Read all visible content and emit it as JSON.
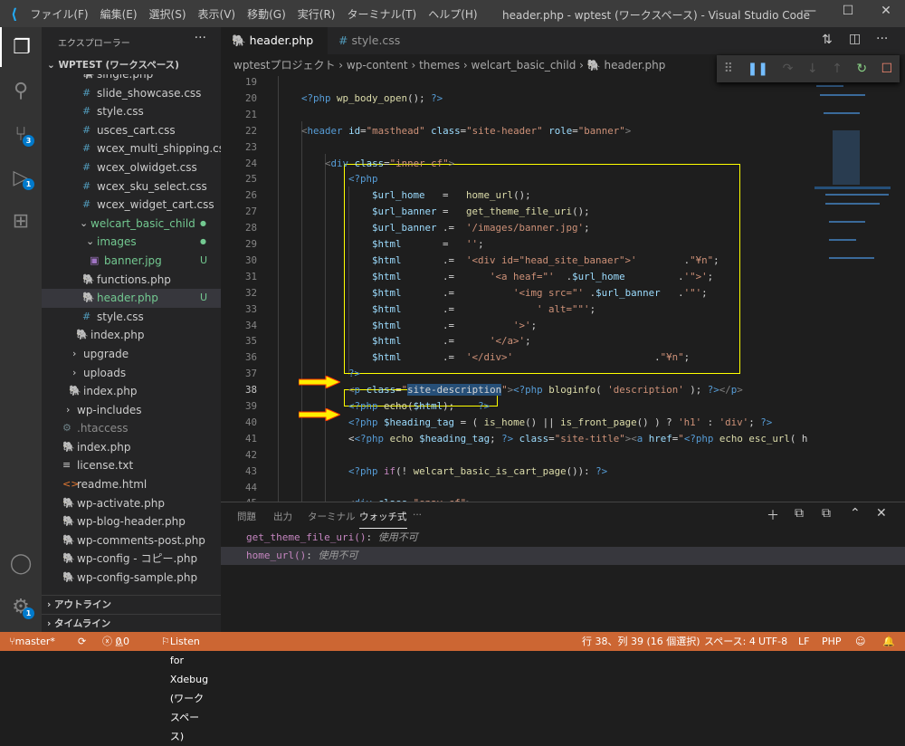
{
  "titlebar": {
    "menus": [
      "ファイル(F)",
      "編集(E)",
      "選択(S)",
      "表示(V)",
      "移動(G)",
      "実行(R)",
      "ターミナル(T)",
      "ヘルプ(H)"
    ],
    "title": "header.php - wptest (ワークスペース) - Visual Studio Code"
  },
  "activity": {
    "scm_badge": "3",
    "debug_badge": "1",
    "settings_badge": "1"
  },
  "sidebar": {
    "header": "エクスプローラー",
    "workspace": "WPTEST (ワークスペース)",
    "items": [
      {
        "label": "single.php",
        "type": "php",
        "indent": 107
      },
      {
        "label": "slide_showcase.css",
        "type": "css",
        "indent": 107
      },
      {
        "label": "style.css",
        "type": "css",
        "indent": 107
      },
      {
        "label": "usces_cart.css",
        "type": "css",
        "indent": 107
      },
      {
        "label": "wcex_multi_shipping.css",
        "type": "css",
        "indent": 107
      },
      {
        "label": "wcex_olwidget.css",
        "type": "css",
        "indent": 107
      },
      {
        "label": "wcex_sku_select.css",
        "type": "css",
        "indent": 107
      },
      {
        "label": "wcex_widget_cart.css",
        "type": "css",
        "indent": 107
      },
      {
        "label": "welcart_basic_child",
        "type": "folder-open",
        "indent": 100,
        "git": "dot"
      },
      {
        "label": "images",
        "type": "folder-open",
        "indent": 107,
        "git": "dot"
      },
      {
        "label": "banner.jpg",
        "type": "image",
        "indent": 115,
        "git": "U"
      },
      {
        "label": "functions.php",
        "type": "php",
        "indent": 107
      },
      {
        "label": "header.php",
        "type": "php",
        "indent": 107,
        "git": "U",
        "selected": true
      },
      {
        "label": "style.css",
        "type": "css",
        "indent": 107
      },
      {
        "label": "index.php",
        "type": "php",
        "indent": 100
      },
      {
        "label": "upgrade",
        "type": "folder",
        "indent": 92
      },
      {
        "label": "uploads",
        "type": "folder",
        "indent": 92
      },
      {
        "label": "index.php",
        "type": "php",
        "indent": 92
      },
      {
        "label": "wp-includes",
        "type": "folder",
        "indent": 85
      },
      {
        "label": ".htaccess",
        "type": "config",
        "indent": 85
      },
      {
        "label": "index.php",
        "type": "php",
        "indent": 85
      },
      {
        "label": "license.txt",
        "type": "text",
        "indent": 85
      },
      {
        "label": "readme.html",
        "type": "html",
        "indent": 85
      },
      {
        "label": "wp-activate.php",
        "type": "php",
        "indent": 85
      },
      {
        "label": "wp-blog-header.php",
        "type": "php",
        "indent": 85
      },
      {
        "label": "wp-comments-post.php",
        "type": "php",
        "indent": 85
      },
      {
        "label": "wp-config - コピー.php",
        "type": "php",
        "indent": 85
      },
      {
        "label": "wp-config-sample.php",
        "type": "php",
        "indent": 85
      }
    ],
    "outline": "アウトライン",
    "timeline": "タイムライン"
  },
  "tabs": [
    {
      "label": "header.php",
      "icon": "php-icon",
      "active": true
    },
    {
      "label": "style.css",
      "icon": "css-icon",
      "active": false
    }
  ],
  "breadcrumb": [
    "wptestプロジェクト",
    "wp-content",
    "themes",
    "welcart_basic_child",
    "header.php"
  ],
  "code": [
    {
      "n": "19",
      "t": []
    },
    {
      "n": "20",
      "t": [
        [
          "    ",
          "o"
        ],
        [
          "<?php",
          "d"
        ],
        [
          " ",
          "o"
        ],
        [
          "wp_body_open",
          "f"
        ],
        [
          "(); ",
          "o"
        ],
        [
          "?>",
          "d"
        ]
      ]
    },
    {
      "n": "21",
      "t": []
    },
    {
      "n": "22",
      "t": [
        [
          "    ",
          "o"
        ],
        [
          "<",
          "p"
        ],
        [
          "header",
          "t"
        ],
        [
          " ",
          "o"
        ],
        [
          "id",
          "a"
        ],
        [
          "=",
          "o"
        ],
        [
          "\"masthead\"",
          "s"
        ],
        [
          " ",
          "o"
        ],
        [
          "class",
          "a"
        ],
        [
          "=",
          "o"
        ],
        [
          "\"site-header\"",
          "s"
        ],
        [
          " ",
          "o"
        ],
        [
          "role",
          "a"
        ],
        [
          "=",
          "o"
        ],
        [
          "\"banner\"",
          "s"
        ],
        [
          ">",
          "p"
        ]
      ]
    },
    {
      "n": "23",
      "t": []
    },
    {
      "n": "24",
      "t": [
        [
          "        ",
          "o"
        ],
        [
          "<",
          "p"
        ],
        [
          "div",
          "t"
        ],
        [
          " ",
          "o"
        ],
        [
          "class",
          "a"
        ],
        [
          "=",
          "o"
        ],
        [
          "\"inner cf\"",
          "s"
        ],
        [
          ">",
          "p"
        ]
      ]
    },
    {
      "n": "25",
      "t": [
        [
          "            ",
          "o"
        ],
        [
          "<?php",
          "d"
        ]
      ]
    },
    {
      "n": "26",
      "t": [
        [
          "                ",
          "o"
        ],
        [
          "$url_home",
          "v"
        ],
        [
          "   =   ",
          "o"
        ],
        [
          "home_url",
          "f"
        ],
        [
          "();",
          "o"
        ]
      ]
    },
    {
      "n": "27",
      "t": [
        [
          "                ",
          "o"
        ],
        [
          "$url_banner",
          "v"
        ],
        [
          " =   ",
          "o"
        ],
        [
          "get_theme_file_uri",
          "f"
        ],
        [
          "();",
          "o"
        ]
      ]
    },
    {
      "n": "28",
      "t": [
        [
          "                ",
          "o"
        ],
        [
          "$url_banner",
          "v"
        ],
        [
          " .=  ",
          "o"
        ],
        [
          "'/images/banner.jpg'",
          "s"
        ],
        [
          ";",
          "o"
        ]
      ]
    },
    {
      "n": "29",
      "t": [
        [
          "                ",
          "o"
        ],
        [
          "$html",
          "v"
        ],
        [
          "       =   ",
          "o"
        ],
        [
          "''",
          "s"
        ],
        [
          ";",
          "o"
        ]
      ]
    },
    {
      "n": "30",
      "t": [
        [
          "                ",
          "o"
        ],
        [
          "$html",
          "v"
        ],
        [
          "       .=  ",
          "o"
        ],
        [
          "'<div id=\"head_site_banaer\">'",
          "s"
        ],
        [
          "        .",
          "o"
        ],
        [
          "\"¥n\"",
          "s"
        ],
        [
          ";",
          "o"
        ]
      ]
    },
    {
      "n": "31",
      "t": [
        [
          "                ",
          "o"
        ],
        [
          "$html",
          "v"
        ],
        [
          "       .=      ",
          "o"
        ],
        [
          "'<a heaf=\"'",
          "s"
        ],
        [
          "  .",
          "o"
        ],
        [
          "$url_home",
          "v"
        ],
        [
          "         .",
          "o"
        ],
        [
          "'\">'",
          "s"
        ],
        [
          ";",
          "o"
        ]
      ]
    },
    {
      "n": "32",
      "t": [
        [
          "                ",
          "o"
        ],
        [
          "$html",
          "v"
        ],
        [
          "       .=          ",
          "o"
        ],
        [
          "'<img src=\"'",
          "s"
        ],
        [
          " .",
          "o"
        ],
        [
          "$url_banner",
          "v"
        ],
        [
          "   .",
          "o"
        ],
        [
          "'\"'",
          "s"
        ],
        [
          ";",
          "o"
        ]
      ]
    },
    {
      "n": "33",
      "t": [
        [
          "                ",
          "o"
        ],
        [
          "$html",
          "v"
        ],
        [
          "       .=              ",
          "o"
        ],
        [
          "' alt=\"\"'",
          "s"
        ],
        [
          ";",
          "o"
        ]
      ]
    },
    {
      "n": "34",
      "t": [
        [
          "                ",
          "o"
        ],
        [
          "$html",
          "v"
        ],
        [
          "       .=          ",
          "o"
        ],
        [
          "'>'",
          "s"
        ],
        [
          ";",
          "o"
        ]
      ]
    },
    {
      "n": "35",
      "t": [
        [
          "                ",
          "o"
        ],
        [
          "$html",
          "v"
        ],
        [
          "       .=      ",
          "o"
        ],
        [
          "'</a>'",
          "s"
        ],
        [
          ";",
          "o"
        ]
      ]
    },
    {
      "n": "36",
      "t": [
        [
          "                ",
          "o"
        ],
        [
          "$html",
          "v"
        ],
        [
          "       .=  ",
          "o"
        ],
        [
          "'</div>'",
          "s"
        ],
        [
          "                        .",
          "o"
        ],
        [
          "\"¥n\"",
          "s"
        ],
        [
          ";",
          "o"
        ]
      ]
    },
    {
      "n": "37",
      "t": [
        [
          "            ",
          "o"
        ],
        [
          "?>",
          "d"
        ]
      ]
    },
    {
      "n": "38",
      "t": [
        [
          "            ",
          "o"
        ],
        [
          "<",
          "p"
        ],
        [
          "p",
          "t"
        ],
        [
          " ",
          "o"
        ],
        [
          "class",
          "a"
        ],
        [
          "=",
          "o"
        ],
        [
          "\"",
          "s"
        ],
        [
          "site-description",
          "sel"
        ],
        [
          "\"",
          "s"
        ],
        [
          ">",
          "p"
        ],
        [
          "<?php",
          "d"
        ],
        [
          " ",
          "o"
        ],
        [
          "bloginfo",
          "f"
        ],
        [
          "( ",
          "o"
        ],
        [
          "'description'",
          "s"
        ],
        [
          " ); ",
          "o"
        ],
        [
          "?>",
          "d"
        ],
        [
          "</",
          "p"
        ],
        [
          "p",
          "t"
        ],
        [
          ">",
          "p"
        ]
      ]
    },
    {
      "n": "39",
      "t": [
        [
          "            ",
          "o"
        ],
        [
          "<?php",
          "d"
        ],
        [
          " ",
          "o"
        ],
        [
          "echo",
          "f"
        ],
        [
          "(",
          "o"
        ],
        [
          "$html",
          "v"
        ],
        [
          ");    ",
          "o"
        ],
        [
          "?>",
          "d"
        ]
      ]
    },
    {
      "n": "40",
      "t": [
        [
          "            ",
          "o"
        ],
        [
          "<?php",
          "d"
        ],
        [
          " ",
          "o"
        ],
        [
          "$heading_tag",
          "v"
        ],
        [
          " = ( ",
          "o"
        ],
        [
          "is_home",
          "f"
        ],
        [
          "() || ",
          "o"
        ],
        [
          "is_front_page",
          "f"
        ],
        [
          "() ) ? ",
          "o"
        ],
        [
          "'h1'",
          "s"
        ],
        [
          " : ",
          "o"
        ],
        [
          "'div'",
          "s"
        ],
        [
          "; ",
          "o"
        ],
        [
          "?>",
          "d"
        ]
      ]
    },
    {
      "n": "41",
      "t": [
        [
          "            ",
          "o"
        ],
        [
          "<",
          "o"
        ],
        [
          "<?php",
          "d"
        ],
        [
          " ",
          "o"
        ],
        [
          "echo",
          "f"
        ],
        [
          " ",
          "o"
        ],
        [
          "$heading_tag",
          "v"
        ],
        [
          "; ",
          "o"
        ],
        [
          "?>",
          "d"
        ],
        [
          " ",
          "o"
        ],
        [
          "class",
          "a"
        ],
        [
          "=",
          "o"
        ],
        [
          "\"site-title\"",
          "s"
        ],
        [
          ">",
          "p"
        ],
        [
          "<",
          "p"
        ],
        [
          "a",
          "t"
        ],
        [
          " ",
          "o"
        ],
        [
          "href",
          "a"
        ],
        [
          "=",
          "o"
        ],
        [
          "\"",
          "s"
        ],
        [
          "<?php",
          "d"
        ],
        [
          " ",
          "o"
        ],
        [
          "echo",
          "f"
        ],
        [
          " ",
          "o"
        ],
        [
          "esc_url",
          "f"
        ],
        [
          "( h",
          "o"
        ]
      ]
    },
    {
      "n": "42",
      "t": []
    },
    {
      "n": "43",
      "t": [
        [
          "            ",
          "o"
        ],
        [
          "<?php",
          "d"
        ],
        [
          " ",
          "o"
        ],
        [
          "if",
          "k"
        ],
        [
          "(! ",
          "o"
        ],
        [
          "welcart_basic_is_cart_page",
          "f"
        ],
        [
          "()): ",
          "o"
        ],
        [
          "?>",
          "d"
        ]
      ]
    },
    {
      "n": "44",
      "t": []
    },
    {
      "n": "45",
      "t": [
        [
          "            ",
          "o"
        ],
        [
          "<",
          "p"
        ],
        [
          "div",
          "t"
        ],
        [
          " ",
          "o"
        ],
        [
          "class",
          "a"
        ],
        [
          "=",
          "o"
        ],
        [
          "\"snav cf\"",
          "s"
        ],
        [
          ">",
          "p"
        ]
      ]
    }
  ],
  "current_line": "38",
  "panel": {
    "tabs": [
      "問題",
      "出力",
      "ターミナル",
      "ウォッチ式",
      "···"
    ],
    "active": "ウォッチ式",
    "watch": [
      {
        "name": "get_theme_file_uri()",
        "value": "使用不可"
      },
      {
        "name": "home_url()",
        "value": "使用不可"
      }
    ]
  },
  "status": {
    "branch": "master*",
    "errors": "0",
    "warnings": "0",
    "debug": "Listen for Xdebug (ワークスペース)",
    "position": "行 38、列 39 (16 個選択)",
    "spaces": "スペース: 4",
    "encoding": "UTF-8",
    "eol": "LF",
    "language": "PHP"
  },
  "colors": {
    "statusbar": "#cc6633",
    "highlight_box": "#ffff00",
    "arrow": "#ffee00",
    "accent": "#007acc"
  }
}
